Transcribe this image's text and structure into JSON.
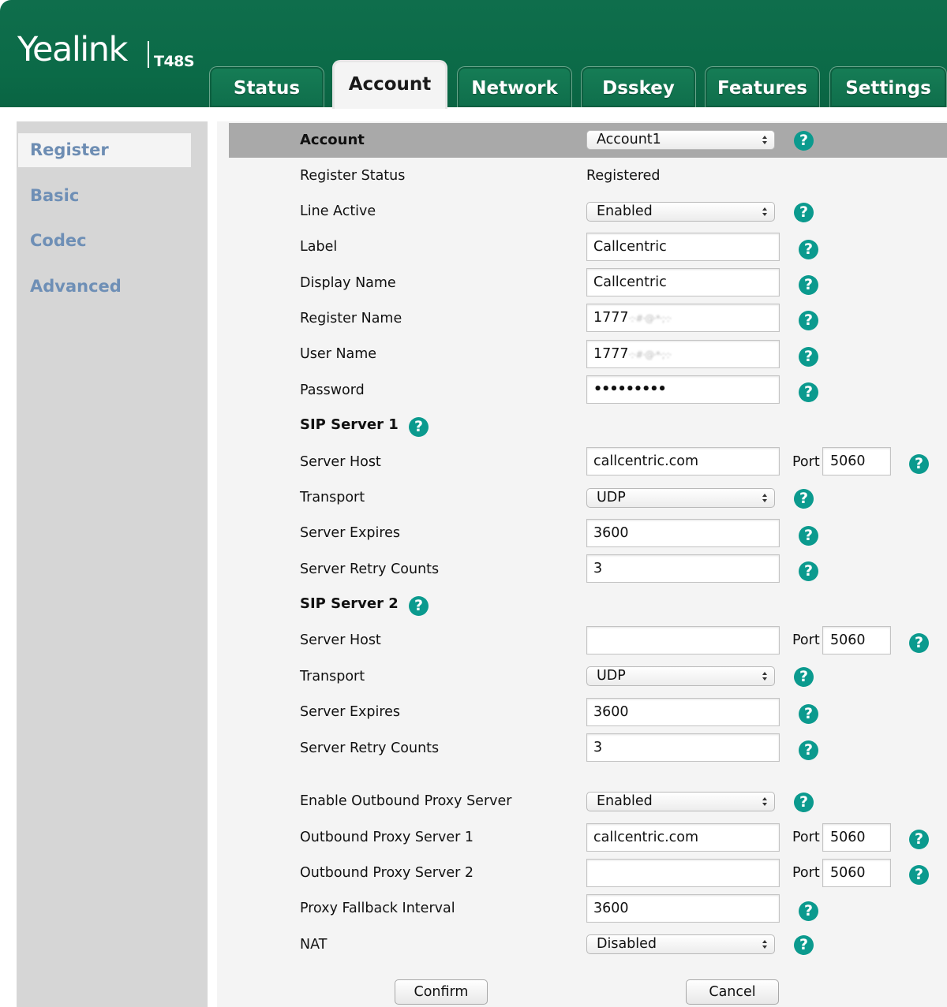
{
  "header": {
    "logo": "Yealink",
    "model": "T48S",
    "tabs": [
      "Status",
      "Account",
      "Network",
      "Dsskey",
      "Features",
      "Settings"
    ],
    "active_tab": "Account"
  },
  "sidebar": {
    "items": [
      "Register",
      "Basic",
      "Codec",
      "Advanced"
    ],
    "active": "Register"
  },
  "form": {
    "account": {
      "label": "Account",
      "value": "Account1"
    },
    "register_status": {
      "label": "Register Status",
      "value": "Registered"
    },
    "line_active": {
      "label": "Line Active",
      "value": "Enabled"
    },
    "label": {
      "label": "Label",
      "value": "Callcentric"
    },
    "display_name": {
      "label": "Display Name",
      "value": "Callcentric"
    },
    "register_name": {
      "label": "Register Name",
      "value": "1777",
      "blurred": "·:·#·@·*·;·:·"
    },
    "user_name": {
      "label": "User Name",
      "value": "1777",
      "blurred": "·:·#·@·*·;·:·"
    },
    "password": {
      "label": "Password",
      "value": "•••••••••"
    },
    "sip_server_1": {
      "heading": "SIP Server 1",
      "server_host": {
        "label": "Server Host",
        "value": "callcentric.com",
        "port_label": "Port",
        "port": "5060"
      },
      "transport": {
        "label": "Transport",
        "value": "UDP"
      },
      "server_expires": {
        "label": "Server Expires",
        "value": "3600"
      },
      "server_retry_counts": {
        "label": "Server Retry Counts",
        "value": "3"
      }
    },
    "sip_server_2": {
      "heading": "SIP Server 2",
      "server_host": {
        "label": "Server Host",
        "value": "",
        "port_label": "Port",
        "port": "5060"
      },
      "transport": {
        "label": "Transport",
        "value": "UDP"
      },
      "server_expires": {
        "label": "Server Expires",
        "value": "3600"
      },
      "server_retry_counts": {
        "label": "Server Retry Counts",
        "value": "3"
      }
    },
    "enable_outbound_proxy": {
      "label": "Enable Outbound Proxy Server",
      "value": "Enabled"
    },
    "outbound_proxy_1": {
      "label": "Outbound Proxy Server 1",
      "value": "callcentric.com",
      "port_label": "Port",
      "port": "5060"
    },
    "outbound_proxy_2": {
      "label": "Outbound Proxy Server 2",
      "value": "",
      "port_label": "Port",
      "port": "5060"
    },
    "proxy_fallback_interval": {
      "label": "Proxy Fallback Interval",
      "value": "3600"
    },
    "nat": {
      "label": "NAT",
      "value": "Disabled"
    }
  },
  "buttons": {
    "confirm": "Confirm",
    "cancel": "Cancel"
  },
  "help_glyph": "?",
  "colors": {
    "header_green": "#0b6a47",
    "help_teal": "#0b9a8e",
    "sidebar_link": "#6e8fb6"
  }
}
